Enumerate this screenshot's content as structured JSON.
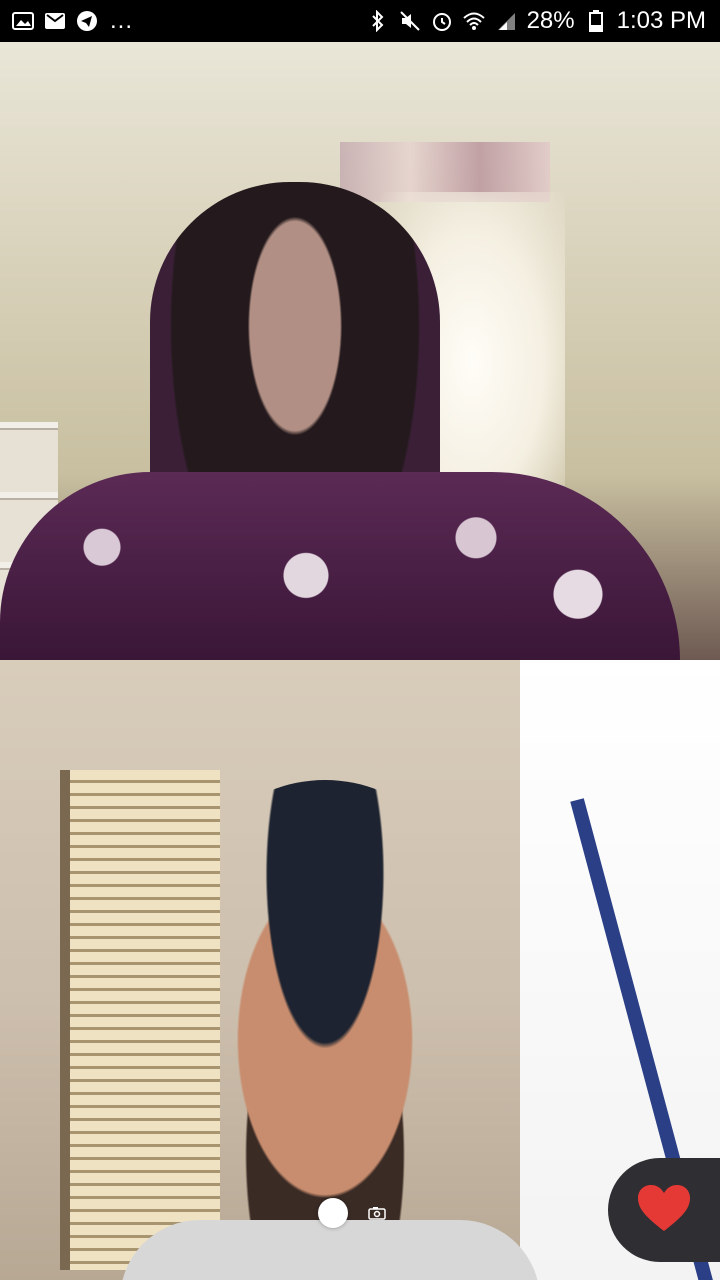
{
  "status_bar": {
    "left_icons": [
      "image-icon",
      "gmail-icon",
      "telegram-icon"
    ],
    "overflow": "...",
    "right_icons": [
      "bluetooth-icon",
      "mute-icon",
      "alarm-icon",
      "wifi-icon",
      "signal-icon"
    ],
    "battery_percent": "28%",
    "time": "1:03 PM"
  },
  "call": {
    "remote_video": "remote-participant-video",
    "local_video": "local-self-video"
  },
  "controls": {
    "record_icon": "record-icon",
    "camera_icon": "camera-icon",
    "like_icon": "heart-icon",
    "accent": "#e53935"
  }
}
